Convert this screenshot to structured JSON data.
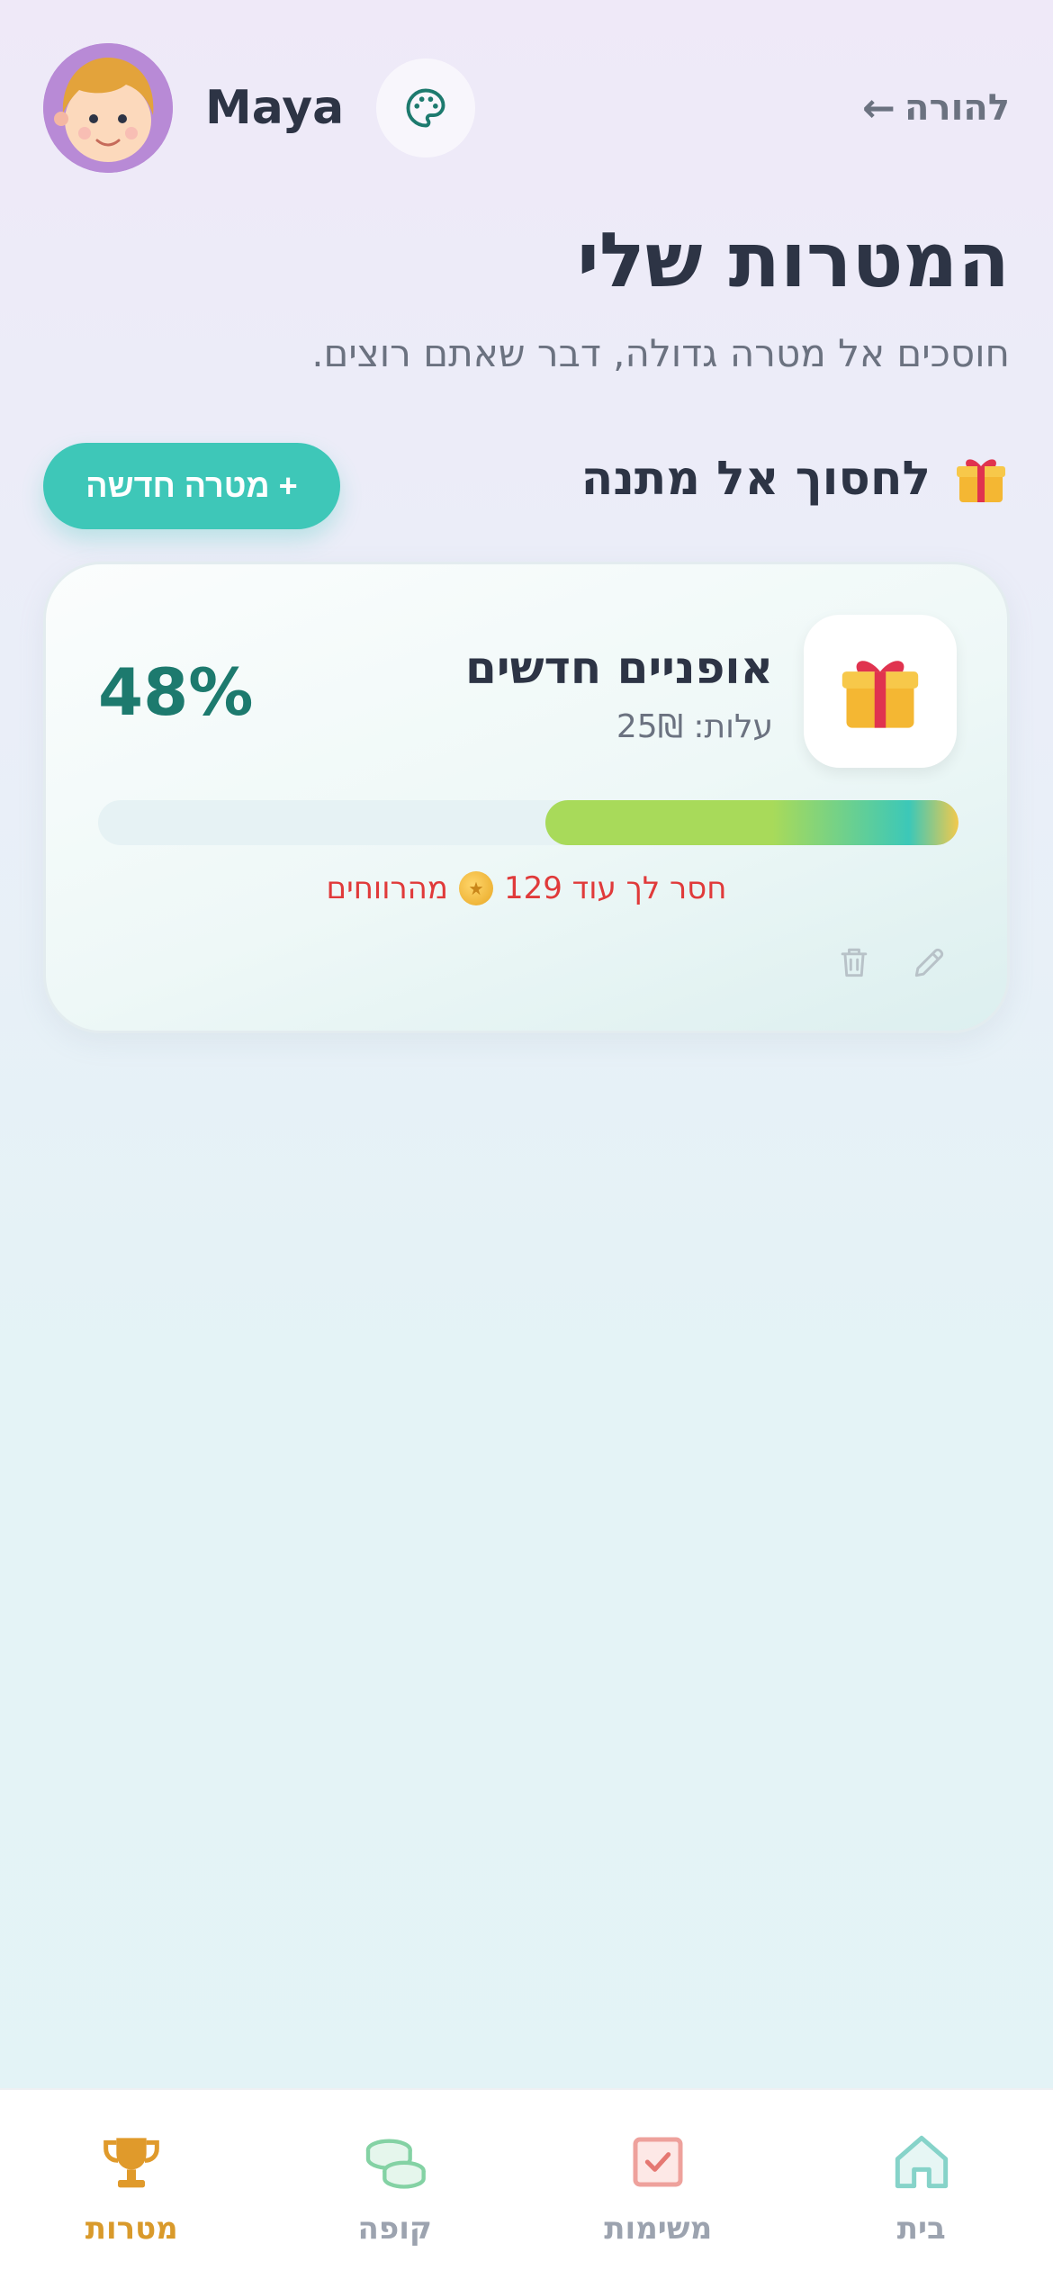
{
  "header": {
    "child_name": "Maya",
    "parent_link_label": "להורה",
    "parent_link_arrow": "←"
  },
  "page": {
    "title": "המטרות שלי",
    "subtitle": "חוסכים אל מטרה גדולה, דבר שאתם רוצים."
  },
  "section": {
    "title": "לחסוך אל מתנה",
    "new_goal_button": "+ מטרה חדשה"
  },
  "goal": {
    "name": "אופניים חדשים",
    "cost": "עלות: 25₪",
    "percent_label": "48%",
    "progress_fraction": 0.48,
    "remaining_before": "חסר לך עוד 129",
    "remaining_after": "מהרווחים"
  },
  "nav": {
    "items": [
      {
        "label": "בית",
        "icon": "home-icon"
      },
      {
        "label": "משימות",
        "icon": "tasks-icon"
      },
      {
        "label": "קופה",
        "icon": "coins-icon"
      },
      {
        "label": "מטרות",
        "icon": "trophy-icon"
      }
    ],
    "active": "מטרות"
  },
  "colors": {
    "accent_teal": "#3ec7b8",
    "percent_green": "#1d7a6e",
    "warning_red": "#e03a3a",
    "active_nav": "#d99a2b"
  }
}
